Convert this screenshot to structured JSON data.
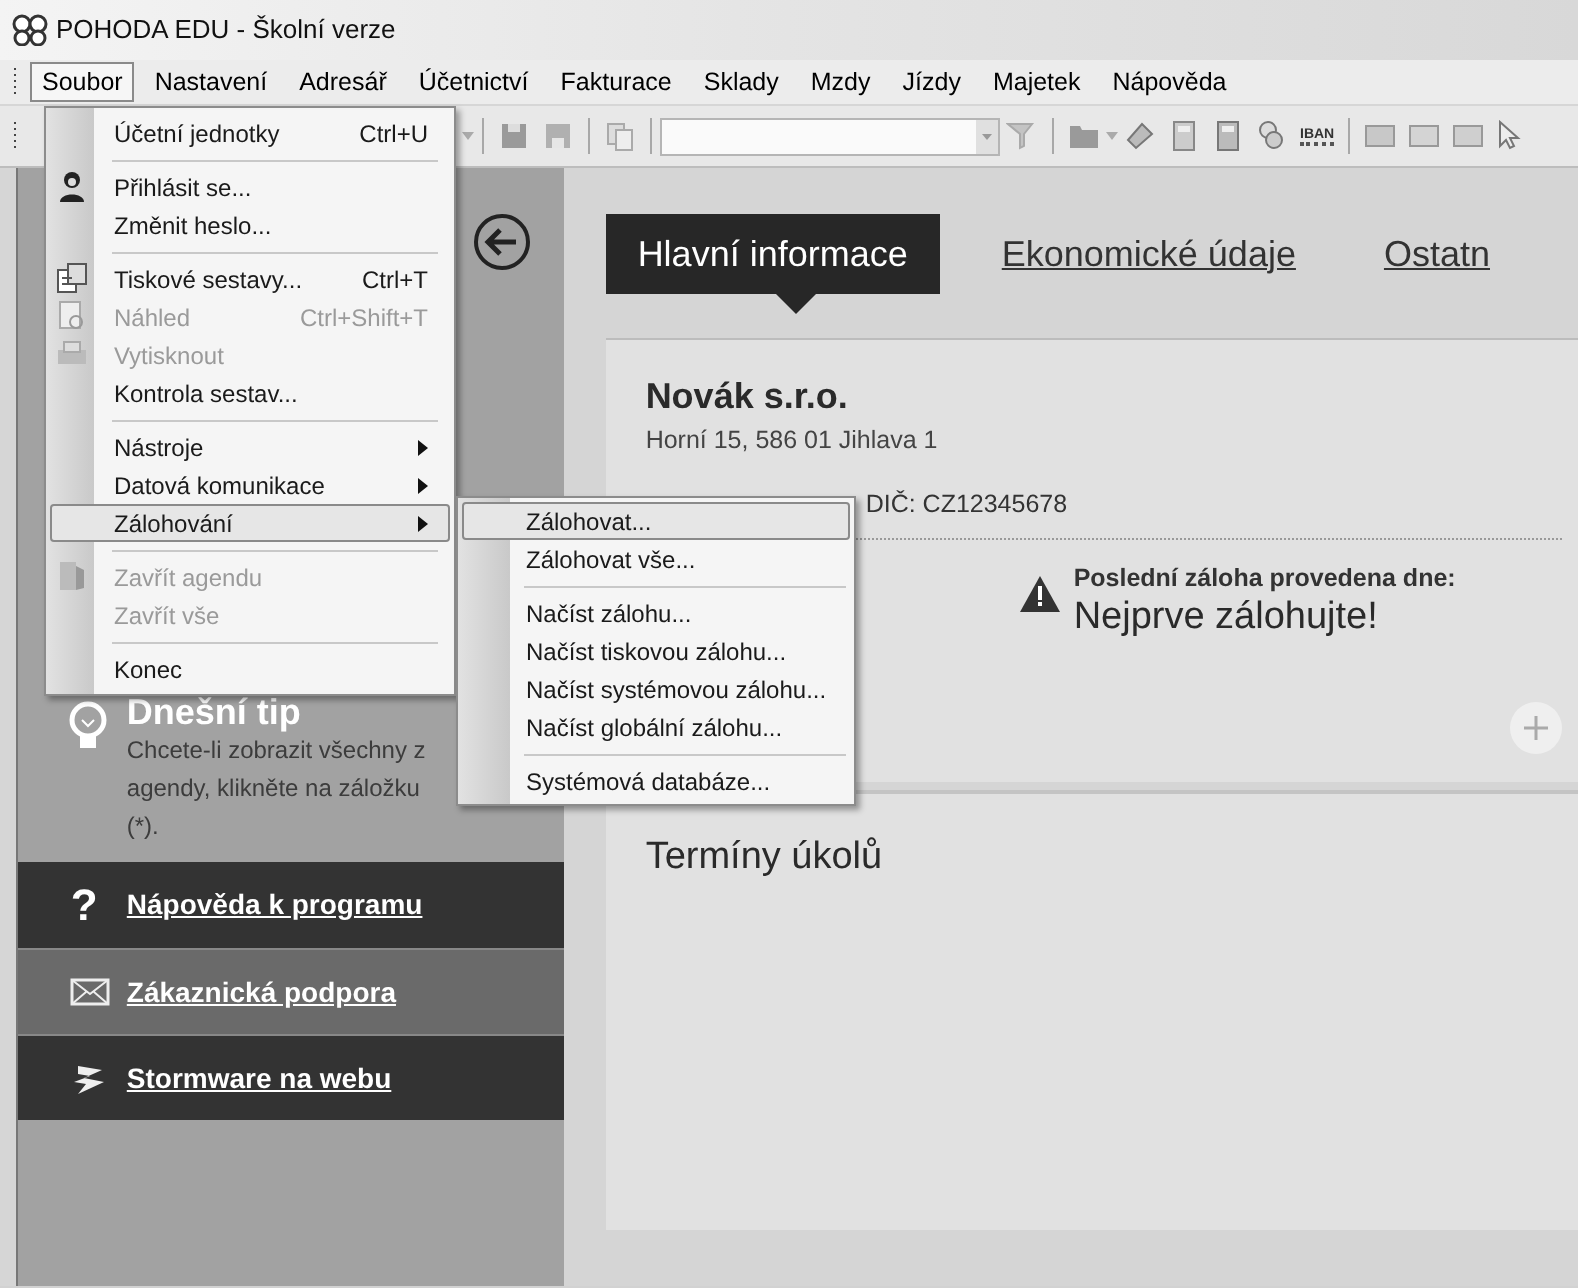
{
  "window": {
    "title": "POHODA EDU - Školní verze"
  },
  "menu_bar": [
    {
      "label": "Soubor",
      "selected": true
    },
    {
      "label": "Nastavení",
      "selected": false
    },
    {
      "label": "Adresář",
      "selected": false
    },
    {
      "label": "Účetnictví",
      "selected": false
    },
    {
      "label": "Fakturace",
      "selected": false
    },
    {
      "label": "Sklady",
      "selected": false
    },
    {
      "label": "Mzdy",
      "selected": false
    },
    {
      "label": "Jízdy",
      "selected": false
    },
    {
      "label": "Majetek",
      "selected": false
    },
    {
      "label": "Nápověda",
      "selected": false
    }
  ],
  "toolbar": {
    "iban_label": "IBAN"
  },
  "file_menu": [
    {
      "kind": "item",
      "label": "Účetní jednotky",
      "shortcut": "Ctrl+U",
      "disabled": false,
      "submenu": false,
      "selected": false
    },
    {
      "kind": "separator"
    },
    {
      "kind": "item",
      "label": "Přihlásit se...",
      "disabled": false,
      "submenu": false,
      "selected": false
    },
    {
      "kind": "item",
      "label": "Změnit heslo...",
      "disabled": false,
      "submenu": false,
      "selected": false
    },
    {
      "kind": "separator"
    },
    {
      "kind": "item",
      "label": "Tiskové sestavy...",
      "shortcut": "Ctrl+T",
      "disabled": false,
      "submenu": false,
      "selected": false
    },
    {
      "kind": "item",
      "label": "Náhled",
      "shortcut": "Ctrl+Shift+T",
      "disabled": true,
      "submenu": false,
      "selected": false
    },
    {
      "kind": "item",
      "label": "Vytisknout",
      "disabled": true,
      "submenu": false,
      "selected": false
    },
    {
      "kind": "item",
      "label": "Kontrola sestav...",
      "disabled": false,
      "submenu": false,
      "selected": false
    },
    {
      "kind": "separator"
    },
    {
      "kind": "item",
      "label": "Nástroje",
      "disabled": false,
      "submenu": true,
      "selected": false
    },
    {
      "kind": "item",
      "label": "Datová komunikace",
      "disabled": false,
      "submenu": true,
      "selected": false
    },
    {
      "kind": "item",
      "label": "Zálohování",
      "disabled": false,
      "submenu": true,
      "selected": true
    },
    {
      "kind": "separator"
    },
    {
      "kind": "item",
      "label": "Zavřít agendu",
      "disabled": true,
      "submenu": false,
      "selected": false
    },
    {
      "kind": "item",
      "label": "Zavřít vše",
      "disabled": true,
      "submenu": false,
      "selected": false
    },
    {
      "kind": "separator"
    },
    {
      "kind": "item",
      "label": "Konec",
      "disabled": false,
      "submenu": false,
      "selected": false
    }
  ],
  "backup_submenu": [
    {
      "kind": "item",
      "label": "Zálohovat...",
      "selected": true
    },
    {
      "kind": "item",
      "label": "Zálohovat vše...",
      "selected": false
    },
    {
      "kind": "separator"
    },
    {
      "kind": "item",
      "label": "Načíst zálohu...",
      "selected": false
    },
    {
      "kind": "item",
      "label": "Načíst tiskovou zálohu...",
      "selected": false
    },
    {
      "kind": "item",
      "label": "Načíst systémovou zálohu...",
      "selected": false
    },
    {
      "kind": "item",
      "label": "Načíst globální zálohu...",
      "selected": false
    },
    {
      "kind": "separator"
    },
    {
      "kind": "item",
      "label": "Systémová databáze...",
      "selected": false
    }
  ],
  "left_panel": {
    "tip_title": "Dnešní tip",
    "tip_lines": [
      "Chcete-li zobrazit všechny z",
      "agendy, klikněte na záložku",
      "(*)."
    ],
    "links": [
      {
        "label": "Nápověda k programu",
        "hovered": false,
        "icon_text": "?"
      },
      {
        "label": "Zákaznická podpora",
        "hovered": true
      },
      {
        "label": "Stormware na webu",
        "hovered": false
      }
    ]
  },
  "tabs": [
    {
      "label": "Hlavní informace",
      "selected": true
    },
    {
      "label": "Ekonomické údaje",
      "selected": false
    },
    {
      "label": "Ostatn",
      "selected": false
    }
  ],
  "company": {
    "name": "Novák s.r.o.",
    "address": "Horní 15, 586 01 Jihlava 1",
    "tax_id": "DIČ: CZ12345678",
    "backup_label": "Poslední záloha provedena dne:",
    "backup_value": "Nejprve zálohujte!"
  },
  "tasks": {
    "title": "Termíny úkolů"
  }
}
